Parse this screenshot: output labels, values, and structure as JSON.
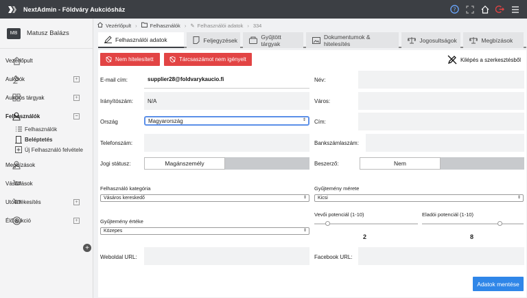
{
  "app": {
    "title": "NextAdmin - Földváry Aukciósház"
  },
  "user": {
    "initials": "MB",
    "name": "Matusz Balázs"
  },
  "sidebar": {
    "items": [
      {
        "label": "Vezérlőpult",
        "icon": "home-icon"
      },
      {
        "label": "Aukciók",
        "icon": "gavel-icon",
        "expand": "+"
      },
      {
        "label": "Aukciós tárgyak",
        "icon": "grid-icon",
        "expand": "+"
      },
      {
        "label": "Felhasználók",
        "icon": "user-icon",
        "expand": "−"
      },
      {
        "label": "Megbízások",
        "icon": "user-icon"
      },
      {
        "label": "Vásárlások",
        "icon": "cart-icon"
      },
      {
        "label": "Utóértékesítés",
        "icon": "cart-icon",
        "expand": "+"
      },
      {
        "label": "Élő aukció",
        "icon": "live-icon",
        "expand": "+"
      }
    ],
    "subitems": [
      {
        "label": "Felhasználók",
        "icon": "list-icon"
      },
      {
        "label": "Beléptetés",
        "icon": "door-icon"
      },
      {
        "label": "Új Felhasználó felvétele",
        "icon": "plus-box-icon"
      }
    ]
  },
  "breadcrumb": {
    "root": "Vezérlőpult",
    "section": "Felhasználók",
    "page": "Felhasználói adatok",
    "id": "334"
  },
  "tabs": [
    {
      "label": "Felhasználói adatok",
      "icon": "pen-icon"
    },
    {
      "label": "Feljegyzések",
      "icon": "note-icon"
    },
    {
      "label": "Gyűjtött tárgyak",
      "icon": "box-icon"
    },
    {
      "label": "Dokumentumok & hitelesítés",
      "icon": "image-icon"
    },
    {
      "label": "Jogosultságok",
      "icon": "scale-icon"
    },
    {
      "label": "Megbízások",
      "icon": "scale-icon"
    }
  ],
  "actions": {
    "not_verified": "Nem hitelesített",
    "no_phone_auction": "Tárcsaszámot nem igényelt",
    "exit_edit": "Kilépés a szerkesztésből",
    "save": "Adatok mentése"
  },
  "form": {
    "email_label": "E-mail cím:",
    "email_value": "supplier28@foldvarykaucio.fi",
    "name_label": "Név:",
    "zip_label": "Irányítószám:",
    "zip_value": "N/A",
    "city_label": "Város:",
    "country_label": "Ország",
    "country_value": "Magyarország",
    "address_label": "Cím:",
    "phone_label": "Telefonszám:",
    "bank_label": "Bankszámlaszám:",
    "legal_label": "Jogi státusz:",
    "legal_value": "Magánszemély",
    "supplier_label": "Beszerző:",
    "supplier_value": "Nem",
    "category_label": "Felhasználó kategória",
    "category_value": "Vásáros kereskedő",
    "collection_size_label": "Gyűjtemény mérete",
    "collection_size_value": "Kicsi",
    "collection_value_label": "Gyűjtemény értéke",
    "collection_value_value": "Közepes",
    "buyer_potential_label": "Vevői potenciál (1-10)",
    "buyer_potential_value": "2",
    "seller_potential_label": "Eladói potenciál (1-10)",
    "seller_potential_value": "8",
    "website_label": "Weboldal URL:",
    "facebook_label": "Facebook URL:"
  },
  "sliders": {
    "buyer": 2,
    "seller": 8,
    "max": 10
  },
  "colors": {
    "topbar": "#3c3f44",
    "danger": "#e24444",
    "primary": "#2f86e8"
  }
}
